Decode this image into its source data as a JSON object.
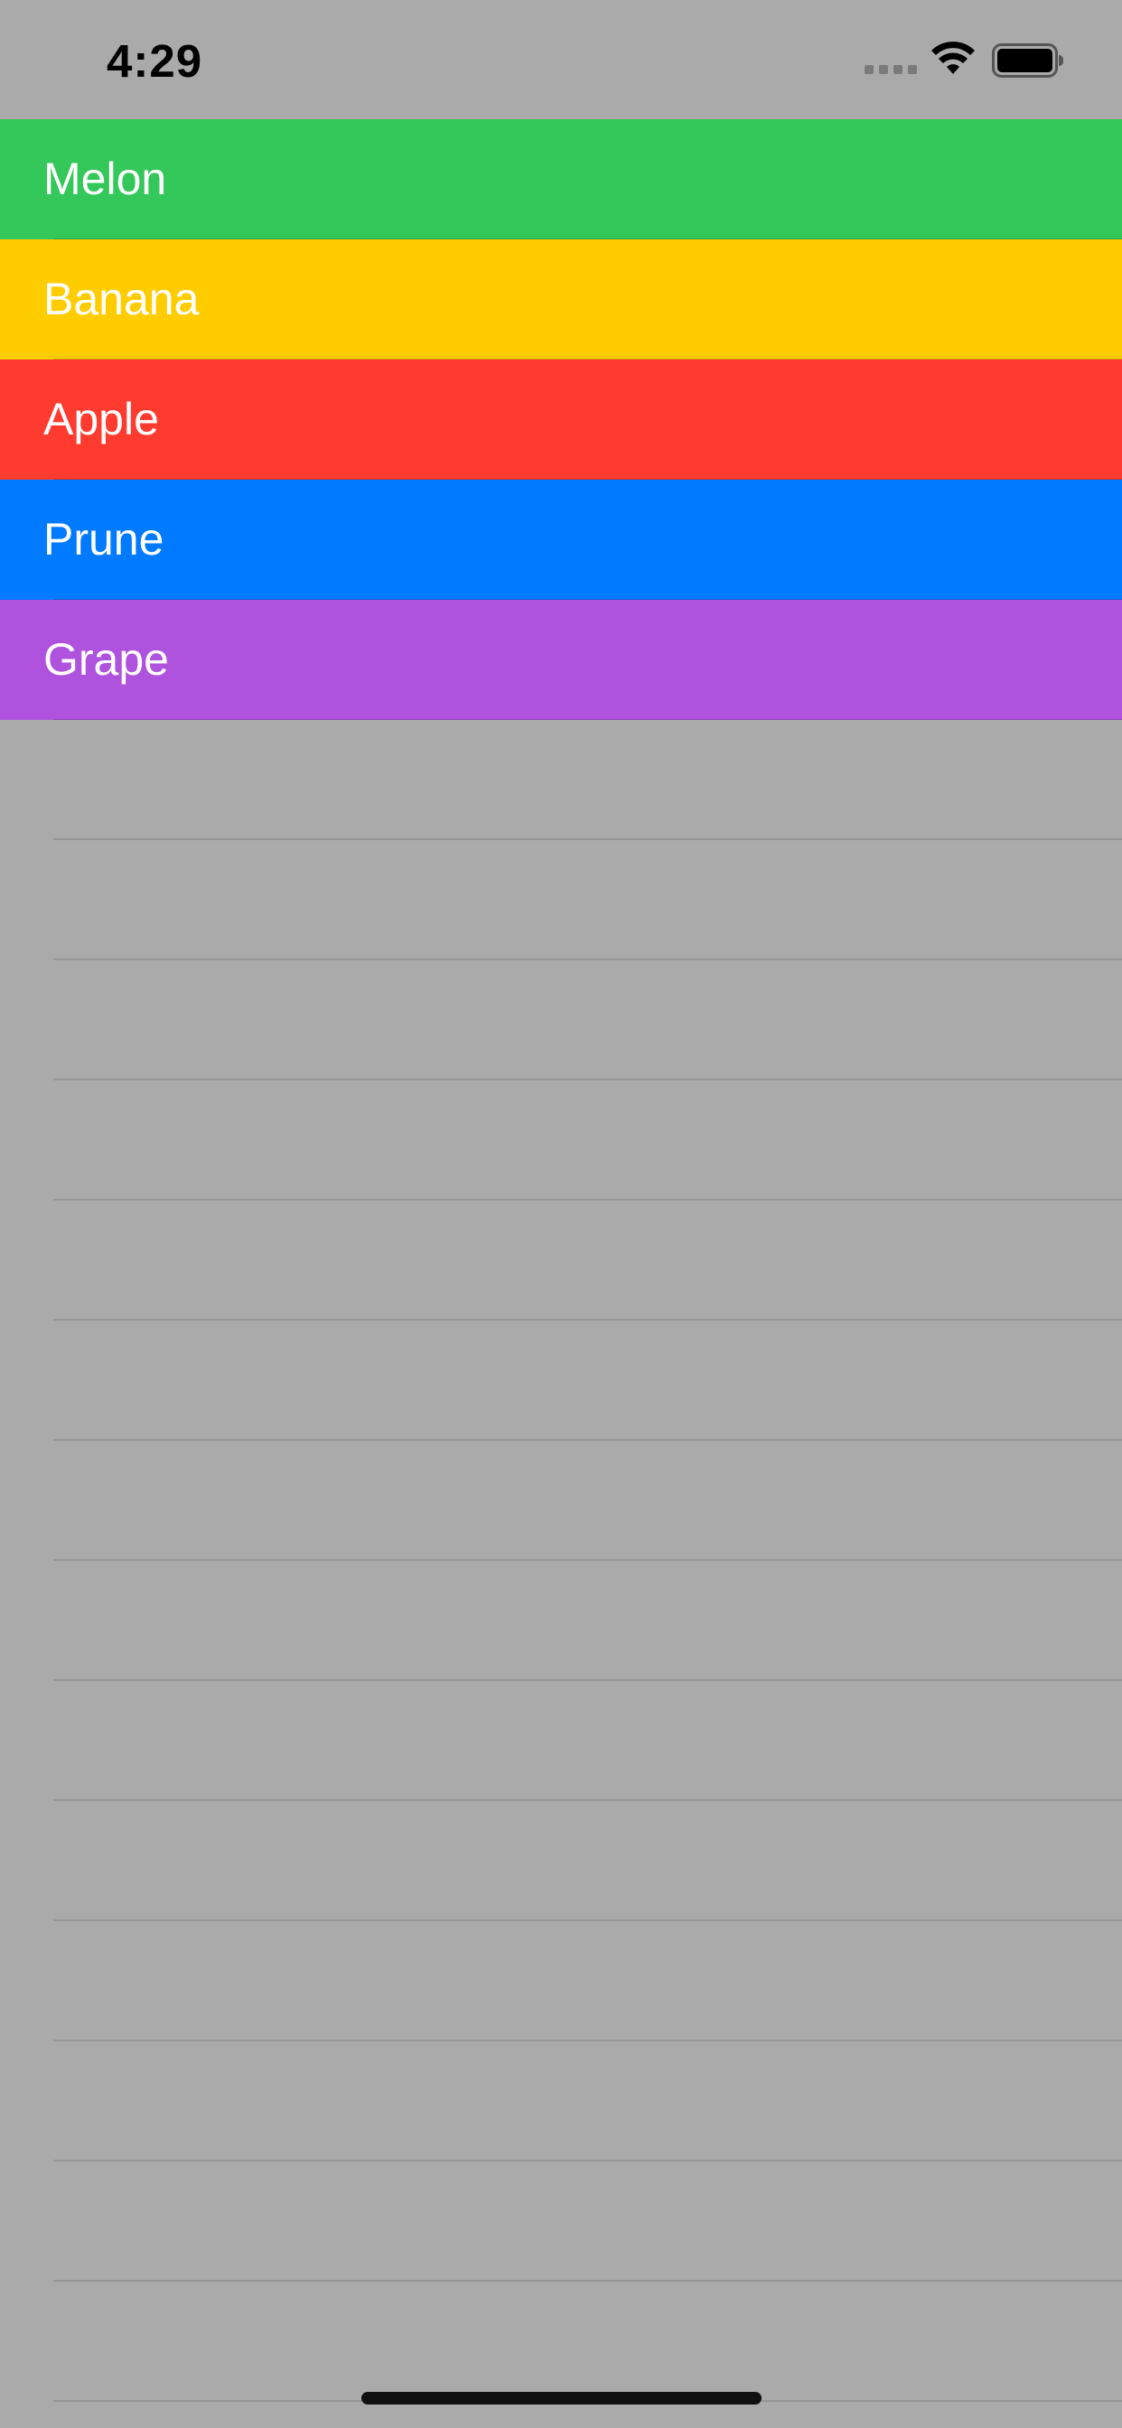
{
  "status_bar": {
    "time": "4:29",
    "icons": [
      "cellular-signal-icon",
      "wifi-icon",
      "battery-icon"
    ]
  },
  "list": {
    "items": [
      {
        "label": "Melon",
        "color": "#34C759"
      },
      {
        "label": "Banana",
        "color": "#FFCC00"
      },
      {
        "label": "Apple",
        "color": "#FF3B30"
      },
      {
        "label": "Prune",
        "color": "#007AFF"
      },
      {
        "label": "Grape",
        "color": "#AF52DE"
      }
    ]
  },
  "colors": {
    "background": "#AAAAAA",
    "separator": "#969696",
    "text": "#FFFFFF"
  }
}
